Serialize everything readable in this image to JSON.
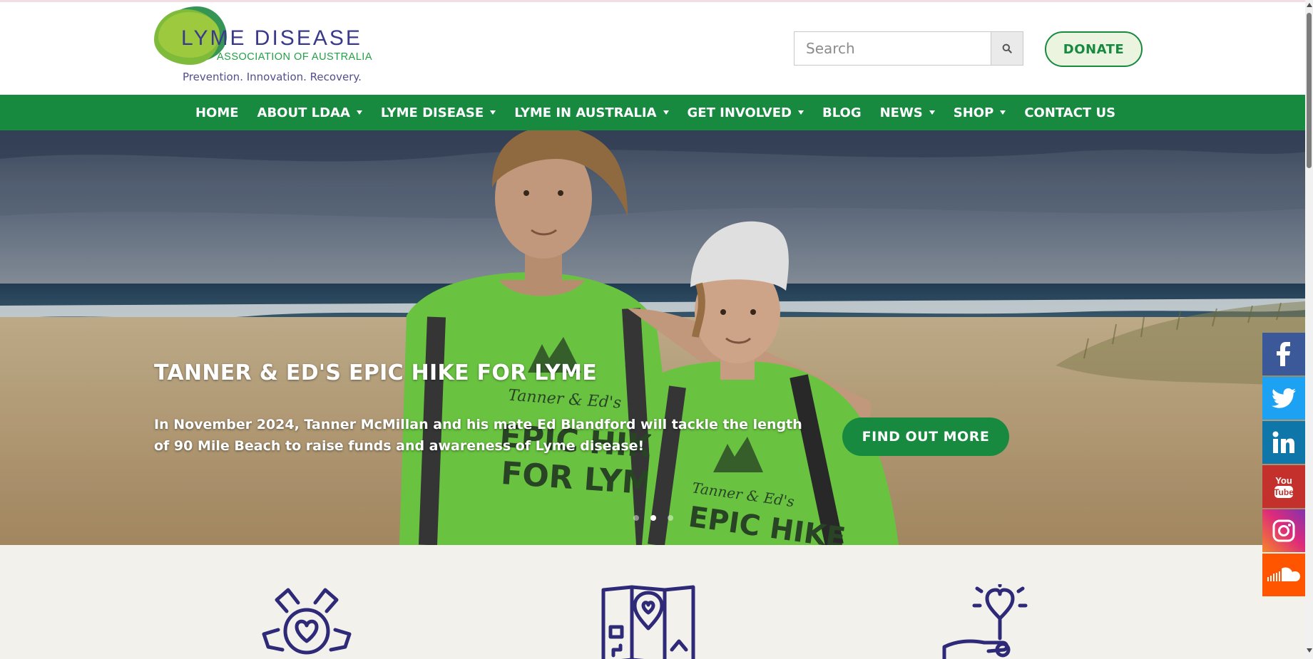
{
  "colors": {
    "brand_green": "#178a40",
    "logo_navy": "#3a3a8c",
    "icon_navy": "#2e2a78",
    "feature_bg": "#f2f1ec"
  },
  "logo": {
    "title": "LYME DISEASE",
    "subtitle": "ASSOCIATION OF AUSTRALIA",
    "tagline": "Prevention. Innovation. Recovery."
  },
  "search": {
    "placeholder": "Search",
    "value": "",
    "icon": "search-icon"
  },
  "donate_label": "DONATE",
  "nav": {
    "items": [
      {
        "label": "HOME",
        "dropdown": false
      },
      {
        "label": "ABOUT LDAA",
        "dropdown": true
      },
      {
        "label": "LYME DISEASE",
        "dropdown": true
      },
      {
        "label": "LYME IN AUSTRALIA",
        "dropdown": true
      },
      {
        "label": "GET INVOLVED",
        "dropdown": true
      },
      {
        "label": "BLOG",
        "dropdown": false
      },
      {
        "label": "NEWS",
        "dropdown": true
      },
      {
        "label": "SHOP",
        "dropdown": true
      },
      {
        "label": "CONTACT US",
        "dropdown": false
      }
    ]
  },
  "hero": {
    "title": "TANNER & ED'S EPIC HIKE FOR LYME",
    "text": "In November 2024, Tanner McMillan and his mate Ed Blandford will tackle the length of 90 Mile Beach to raise funds and awareness of Lyme disease!",
    "cta_label": "FIND OUT MORE",
    "slide_count": 3,
    "active_slide": 2,
    "shirt_text": {
      "top": "Tanner & Ed's",
      "line1": "EPIC HIKE",
      "line2": "FOR LYME"
    }
  },
  "features": {
    "icons": [
      "hands-heart-icon",
      "map-pin-heart-icon",
      "hand-heart-idea-icon"
    ]
  },
  "social": [
    {
      "name": "facebook-icon",
      "glyph": "f",
      "color": "#3b5998"
    },
    {
      "name": "twitter-icon",
      "glyph": "",
      "color": "#1da1f2"
    },
    {
      "name": "linkedin-icon",
      "glyph": "in",
      "color": "#0e76a8"
    },
    {
      "name": "youtube-icon",
      "glyph": "You Tube",
      "color": "#c4302b"
    },
    {
      "name": "instagram-icon",
      "glyph": "",
      "color": "#e1306c"
    },
    {
      "name": "soundcloud-icon",
      "glyph": "",
      "color": "#ff5500"
    }
  ]
}
